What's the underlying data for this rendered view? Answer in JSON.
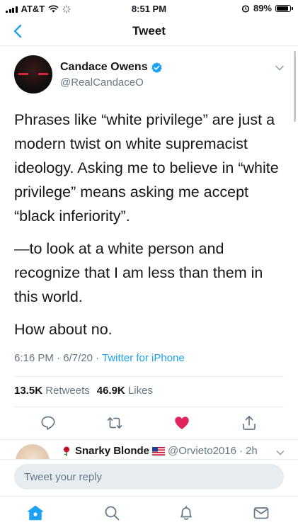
{
  "status_bar": {
    "carrier": "AT&T",
    "time": "8:51 PM",
    "battery": "89%",
    "battery_level": 0.89
  },
  "header": {
    "title": "Tweet"
  },
  "tweet": {
    "author_name": "Candace Owens",
    "author_handle": "@RealCandaceO",
    "paragraphs": [
      "Phrases like “white privilege” are just a modern twist on white supremacist ideology. Asking me to believe in “white privilege” means asking me accept “black inferiority”.",
      "—to look at a white person and recognize that I am less than them in this world.",
      "How about no."
    ],
    "time": "6:16 PM",
    "date": "6/7/20",
    "separator": "·",
    "source": "Twitter for iPhone",
    "retweets_count": "13.5K",
    "retweets_label": "Retweets",
    "likes_count": "46.9K",
    "likes_label": "Likes"
  },
  "reply_preview": {
    "name": "Snarky Blonde",
    "handle": "@Orvieto2016",
    "separator": "·",
    "age": "2h"
  },
  "compose": {
    "placeholder": "Tweet your reply"
  },
  "icons": {
    "back": "chevron-left-icon",
    "verified": "verified-badge-icon",
    "caret": "chevron-down-icon",
    "reply": "reply-icon",
    "retweet": "retweet-icon",
    "like": "heart-icon",
    "share": "share-icon",
    "home": "home-icon",
    "search": "search-icon",
    "notifications": "bell-icon",
    "messages": "envelope-icon"
  },
  "colors": {
    "accent": "#1da1f2",
    "like": "#e0245e",
    "text": "#14171a",
    "secondary": "#657786"
  }
}
